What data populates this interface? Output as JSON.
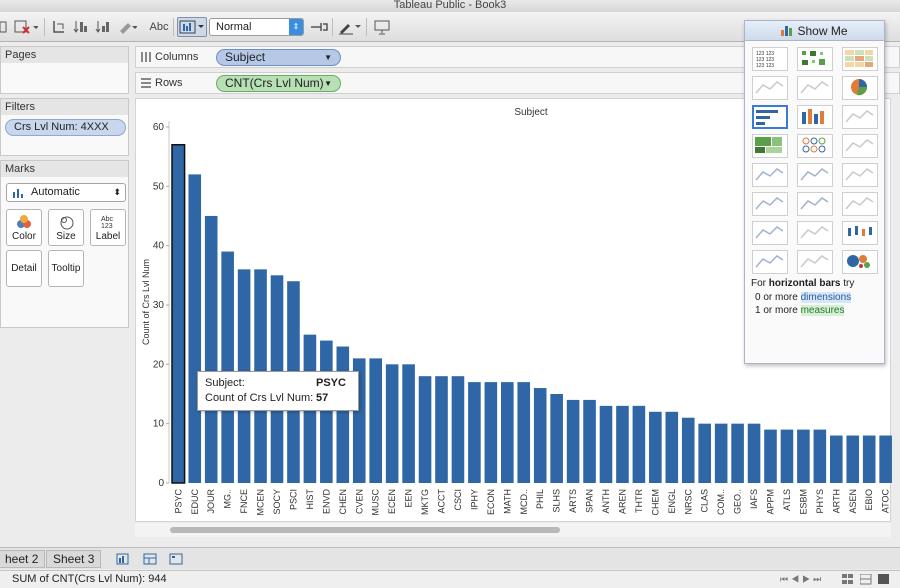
{
  "window": {
    "title": "Tableau Public - Book3"
  },
  "toolbar": {
    "mark_size_value": "Normal",
    "abc_label": "Abc"
  },
  "pages": {
    "title": "Pages"
  },
  "filters": {
    "title": "Filters",
    "items": [
      "Crs Lvl Num: 4XXX"
    ]
  },
  "marks": {
    "title": "Marks",
    "type": "Automatic",
    "cards": [
      "Color",
      "Size",
      "Label",
      "Detail",
      "Tooltip"
    ]
  },
  "shelves": {
    "columns_label": "Columns",
    "columns_pill": "Subject",
    "rows_label": "Rows",
    "rows_pill": "CNT(Crs Lvl Num)"
  },
  "chart_data": {
    "type": "bar",
    "title": "Subject",
    "ylabel": "Count of Crs Lvl Num",
    "ylim": [
      0,
      61
    ],
    "yticks": [
      0,
      10,
      20,
      30,
      40,
      50,
      60
    ],
    "bar_color": "#2f67a6",
    "categories": [
      "PSYC",
      "EDUC",
      "JOUR",
      "MG..",
      "FNCE",
      "MCEN",
      "SOCY",
      "PSCI",
      "HIST",
      "ENVD",
      "CHEN",
      "CVEN",
      "MUSC",
      "ECEN",
      "EEN",
      "MKTG",
      "ACCT",
      "CSCI",
      "IPHY",
      "ECON",
      "MATH",
      "MCD..",
      "PHIL",
      "SLHS",
      "ARTS",
      "SPAN",
      "ANTH",
      "AREN",
      "THTR",
      "CHEM",
      "ENGL",
      "NRSC",
      "CLAS",
      "COM..",
      "GEO..",
      "IAFS",
      "APPM",
      "ATLS",
      "ESBM",
      "PHYS",
      "ARTH",
      "ASEN",
      "EBIO",
      "ATOC"
    ],
    "values": [
      57,
      52,
      45,
      39,
      36,
      36,
      35,
      34,
      25,
      24,
      23,
      21,
      21,
      20,
      20,
      18,
      18,
      18,
      17,
      17,
      17,
      17,
      16,
      15,
      14,
      14,
      13,
      13,
      13,
      12,
      12,
      11,
      10,
      10,
      10,
      10,
      9,
      9,
      9,
      9,
      8,
      8,
      8,
      8
    ],
    "highlighted": "PSYC"
  },
  "tooltip": {
    "subject_label": "Subject:",
    "subject_value": "PSYC",
    "count_label": "Count of Crs Lvl Num:",
    "count_value": "57"
  },
  "showme": {
    "title": "Show Me",
    "hint_prefix": "For ",
    "hint_bold": "horizontal bars",
    "hint_suffix": " try",
    "line1_pre": "0 or more ",
    "line1_hl": "dimensions",
    "line2_pre": "1 or more ",
    "line2_hl": "measures"
  },
  "tabs": {
    "sheet2": "heet 2",
    "sheet3": "Sheet 3"
  },
  "status": {
    "text": "SUM of CNT(Crs Lvl Num): 944"
  }
}
